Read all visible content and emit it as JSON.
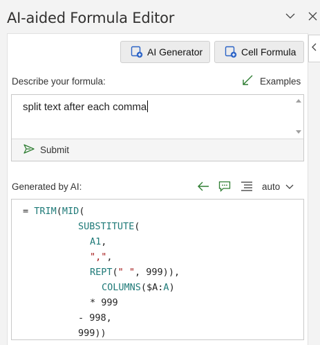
{
  "window": {
    "title": "AI-aided Formula Editor"
  },
  "toolbar": {
    "ai_generator_label": "AI Generator",
    "cell_formula_label": "Cell Formula"
  },
  "describe": {
    "label": "Describe your formula:",
    "examples_label": "Examples",
    "input_value": "split text after each comma",
    "submit_label": "Submit"
  },
  "generated": {
    "label": "Generated by AI:",
    "mode_value": "auto",
    "code": {
      "l1_eq": "= ",
      "l1_fn1": "TRIM",
      "l1_p1": "(",
      "l1_fn2": "MID",
      "l1_p2": "(",
      "l2_fn": "SUBSTITUTE",
      "l2_p": "(",
      "l3_ref": "A1",
      "l3_c": ",",
      "l4_str": "\",\"",
      "l4_c": ",",
      "l5_fn": "REPT",
      "l5_a": "(",
      "l5_str": "\" \"",
      "l5_b": ", 999)),",
      "l6_fn": "COLUMNS",
      "l6_a": "($A:",
      "l6_ref": "A",
      "l6_b": ")",
      "l7": "* 999",
      "l8": "- 998,",
      "l9": "999))"
    }
  },
  "colors": {
    "accent_blue": "#2b63c6",
    "function_teal": "#1f7a78",
    "string_red": "#a31515",
    "examples_green": "#2e7d32"
  },
  "icons": [
    "chevron-down-icon",
    "close-icon",
    "chevron-left-icon",
    "ai-generator-icon",
    "cell-formula-icon",
    "examples-arrow-icon",
    "send-icon",
    "back-arrow-icon",
    "comment-icon",
    "format-lines-icon"
  ]
}
